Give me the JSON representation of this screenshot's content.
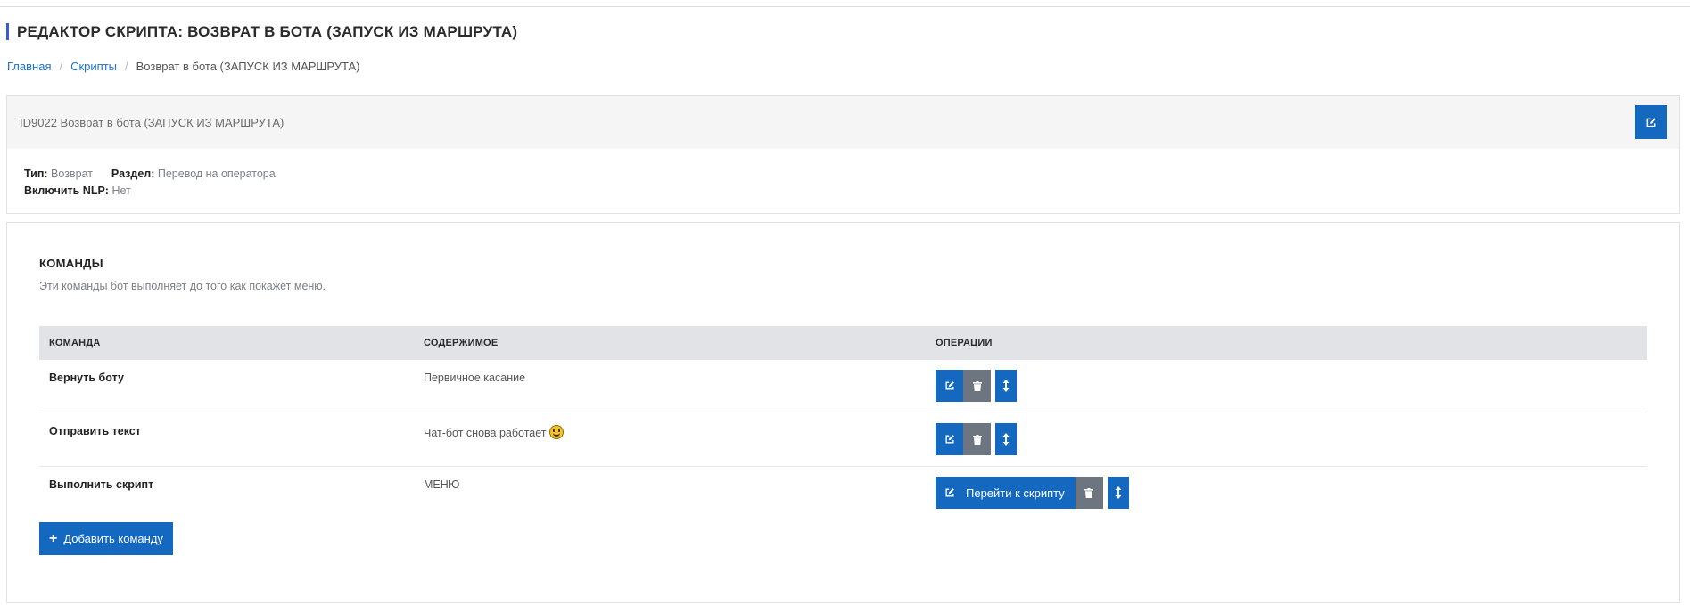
{
  "page": {
    "title": "РЕДАКТОР СКРИПТА: ВОЗВРАТ В БОТА (ЗАПУСК ИЗ МАРШРУТА)"
  },
  "breadcrumb": {
    "items": [
      "Главная",
      "Скрипты"
    ],
    "separator": "/",
    "current": "Возврат в бота (ЗАПУСК ИЗ МАРШРУТА)"
  },
  "script_info": {
    "header": "ID9022 Возврат в бота (ЗАПУСК ИЗ МАРШРУТА)",
    "type_label": "Тип:",
    "type_value": "Возврат",
    "section_label": "Раздел:",
    "section_value": "Перевод на оператора",
    "nlp_label": "Включить NLP:",
    "nlp_value": "Нет"
  },
  "commands": {
    "title": "КОМАНДЫ",
    "description": "Эти команды бот выполняет до того как покажет меню.",
    "columns": [
      "КОМАНДА",
      "СОДЕРЖИМОЕ",
      "ОПЕРАЦИИ"
    ],
    "rows": [
      {
        "command": "Вернуть боту",
        "content": "Первичное касание"
      },
      {
        "command": "Отправить текст",
        "content": "Чат-бот снова работает",
        "emoji": "smiling-face-icon"
      },
      {
        "command": "Выполнить скрипт",
        "content": "МЕНЮ",
        "goto_label": "Перейти к скрипту"
      }
    ],
    "add_label": "Добавить команду"
  },
  "colors": {
    "accent": "#1468c0",
    "title_bar": "#3a5bd9",
    "gray_button": "#6d7680"
  },
  "icons": {
    "edit": "pencil-square-icon",
    "delete": "trash-icon",
    "move": "vertical-arrows-icon",
    "add": "plus-icon"
  }
}
